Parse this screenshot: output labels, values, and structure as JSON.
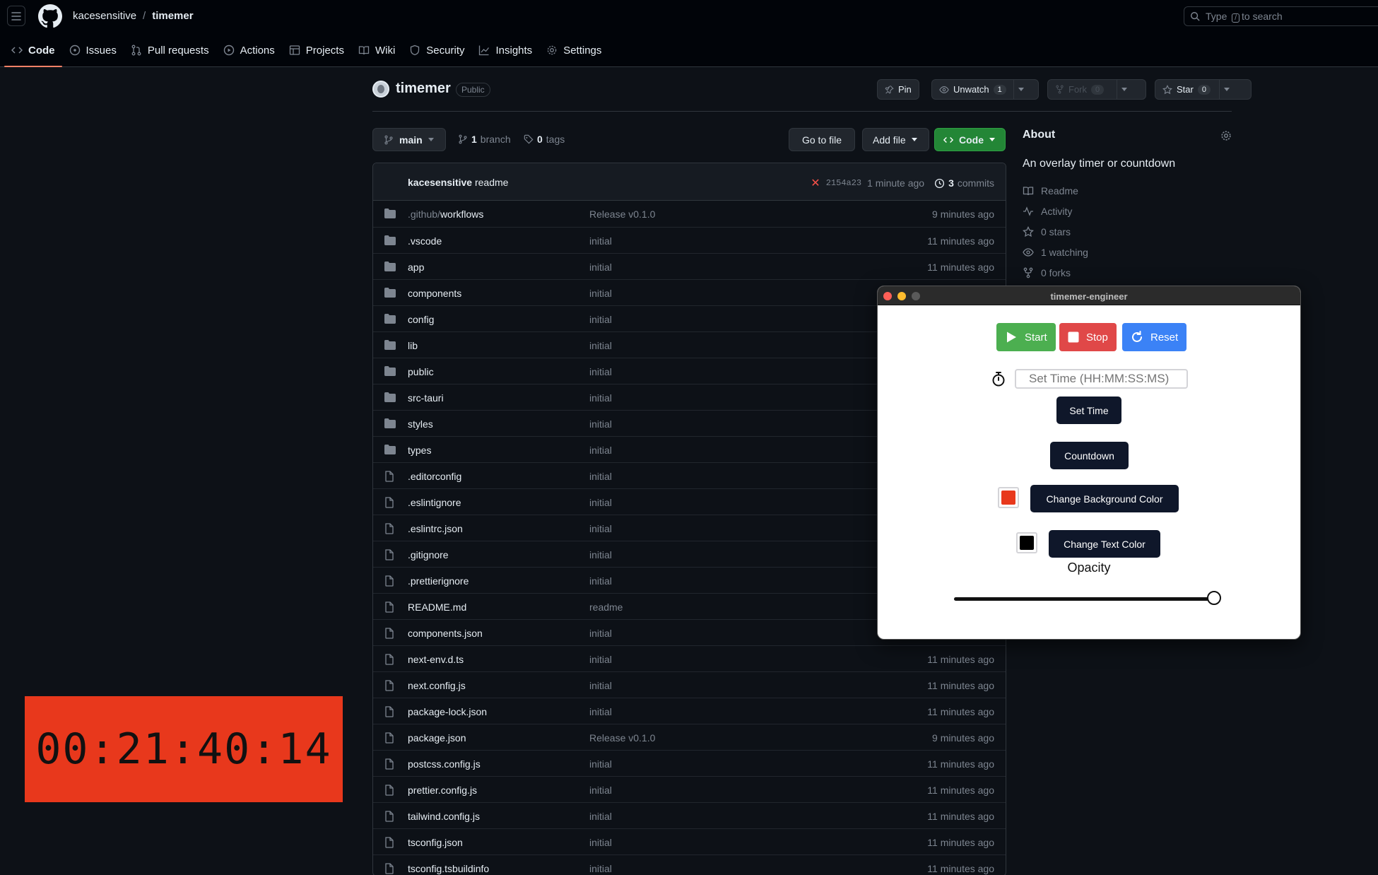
{
  "header": {
    "owner": "kacesensitive",
    "separator": "/",
    "repo": "timemer",
    "search_prefix": "Type",
    "search_key": "/",
    "search_suffix": "to search"
  },
  "nav": [
    {
      "label": "Code",
      "icon": "code-icon",
      "active": true
    },
    {
      "label": "Issues",
      "icon": "issue-icon"
    },
    {
      "label": "Pull requests",
      "icon": "pull-request-icon"
    },
    {
      "label": "Actions",
      "icon": "play-icon"
    },
    {
      "label": "Projects",
      "icon": "table-icon"
    },
    {
      "label": "Wiki",
      "icon": "book-icon"
    },
    {
      "label": "Security",
      "icon": "shield-icon"
    },
    {
      "label": "Insights",
      "icon": "graph-icon"
    },
    {
      "label": "Settings",
      "icon": "gear-icon"
    }
  ],
  "repo": {
    "title": "timemer",
    "visibility": "Public",
    "pin_label": "Pin",
    "unwatch_label": "Unwatch",
    "unwatch_count": "1",
    "fork_label": "Fork",
    "fork_count": "0",
    "star_label": "Star",
    "star_count": "0"
  },
  "toolbar": {
    "branch": "main",
    "branch_count": "1",
    "branch_text": "branch",
    "tag_count": "0",
    "tag_text": "tags",
    "go_to_file": "Go to file",
    "add_file": "Add file",
    "code": "Code"
  },
  "commit": {
    "author": "kacesensitive",
    "message": "readme",
    "sha": "2154a23",
    "time": "1 minute ago",
    "count": "3",
    "count_text": "commits"
  },
  "files": [
    {
      "prefix": ".github/",
      "name": "workflows",
      "type": "folder",
      "message": "Release v0.1.0",
      "age": "9 minutes ago"
    },
    {
      "name": ".vscode",
      "type": "folder",
      "message": "initial",
      "age": "11 minutes ago"
    },
    {
      "name": "app",
      "type": "folder",
      "message": "initial",
      "age": "11 minutes ago"
    },
    {
      "name": "components",
      "type": "folder",
      "message": "initial",
      "age": ""
    },
    {
      "name": "config",
      "type": "folder",
      "message": "initial",
      "age": ""
    },
    {
      "name": "lib",
      "type": "folder",
      "message": "initial",
      "age": ""
    },
    {
      "name": "public",
      "type": "folder",
      "message": "initial",
      "age": ""
    },
    {
      "name": "src-tauri",
      "type": "folder",
      "message": "initial",
      "age": ""
    },
    {
      "name": "styles",
      "type": "folder",
      "message": "initial",
      "age": ""
    },
    {
      "name": "types",
      "type": "folder",
      "message": "initial",
      "age": ""
    },
    {
      "name": ".editorconfig",
      "type": "file",
      "message": "initial",
      "age": ""
    },
    {
      "name": ".eslintignore",
      "type": "file",
      "message": "initial",
      "age": ""
    },
    {
      "name": ".eslintrc.json",
      "type": "file",
      "message": "initial",
      "age": ""
    },
    {
      "name": ".gitignore",
      "type": "file",
      "message": "initial",
      "age": ""
    },
    {
      "name": ".prettierignore",
      "type": "file",
      "message": "initial",
      "age": ""
    },
    {
      "name": "README.md",
      "type": "file",
      "message": "readme",
      "age": ""
    },
    {
      "name": "components.json",
      "type": "file",
      "message": "initial",
      "age": ""
    },
    {
      "name": "next-env.d.ts",
      "type": "file",
      "message": "initial",
      "age": "11 minutes ago"
    },
    {
      "name": "next.config.js",
      "type": "file",
      "message": "initial",
      "age": "11 minutes ago"
    },
    {
      "name": "package-lock.json",
      "type": "file",
      "message": "initial",
      "age": "11 minutes ago"
    },
    {
      "name": "package.json",
      "type": "file",
      "message": "Release v0.1.0",
      "age": "9 minutes ago"
    },
    {
      "name": "postcss.config.js",
      "type": "file",
      "message": "initial",
      "age": "11 minutes ago"
    },
    {
      "name": "prettier.config.js",
      "type": "file",
      "message": "initial",
      "age": "11 minutes ago"
    },
    {
      "name": "tailwind.config.js",
      "type": "file",
      "message": "initial",
      "age": "11 minutes ago"
    },
    {
      "name": "tsconfig.json",
      "type": "file",
      "message": "initial",
      "age": "11 minutes ago"
    },
    {
      "name": "tsconfig.tsbuildinfo",
      "type": "file",
      "message": "initial",
      "age": "11 minutes ago"
    }
  ],
  "about": {
    "title": "About",
    "description": "An overlay timer or countdown",
    "items": [
      {
        "icon": "book-icon",
        "label": "Readme"
      },
      {
        "icon": "pulse-icon",
        "label": "Activity"
      },
      {
        "icon": "star-icon",
        "label": "0 stars"
      },
      {
        "icon": "eye-icon",
        "label": "1 watching"
      },
      {
        "icon": "fork-icon",
        "label": "0 forks"
      }
    ]
  },
  "overlay_timer": {
    "display": "00:21:40:14",
    "background": "#e8381c"
  },
  "app_window": {
    "title": "timemer-engineer",
    "start": "Start",
    "stop": "Stop",
    "reset": "Reset",
    "time_placeholder": "Set Time (HH:MM:SS:MS)",
    "set_time": "Set Time",
    "countdown": "Countdown",
    "change_bg": "Change Background Color",
    "bg_color": "#e8381c",
    "change_text": "Change Text Color",
    "text_color": "#000000",
    "opacity_label": "Opacity",
    "opacity_value": 1.0,
    "colors": {
      "start": "#4caf50",
      "stop": "#e04848",
      "reset": "#3b82f6"
    }
  }
}
